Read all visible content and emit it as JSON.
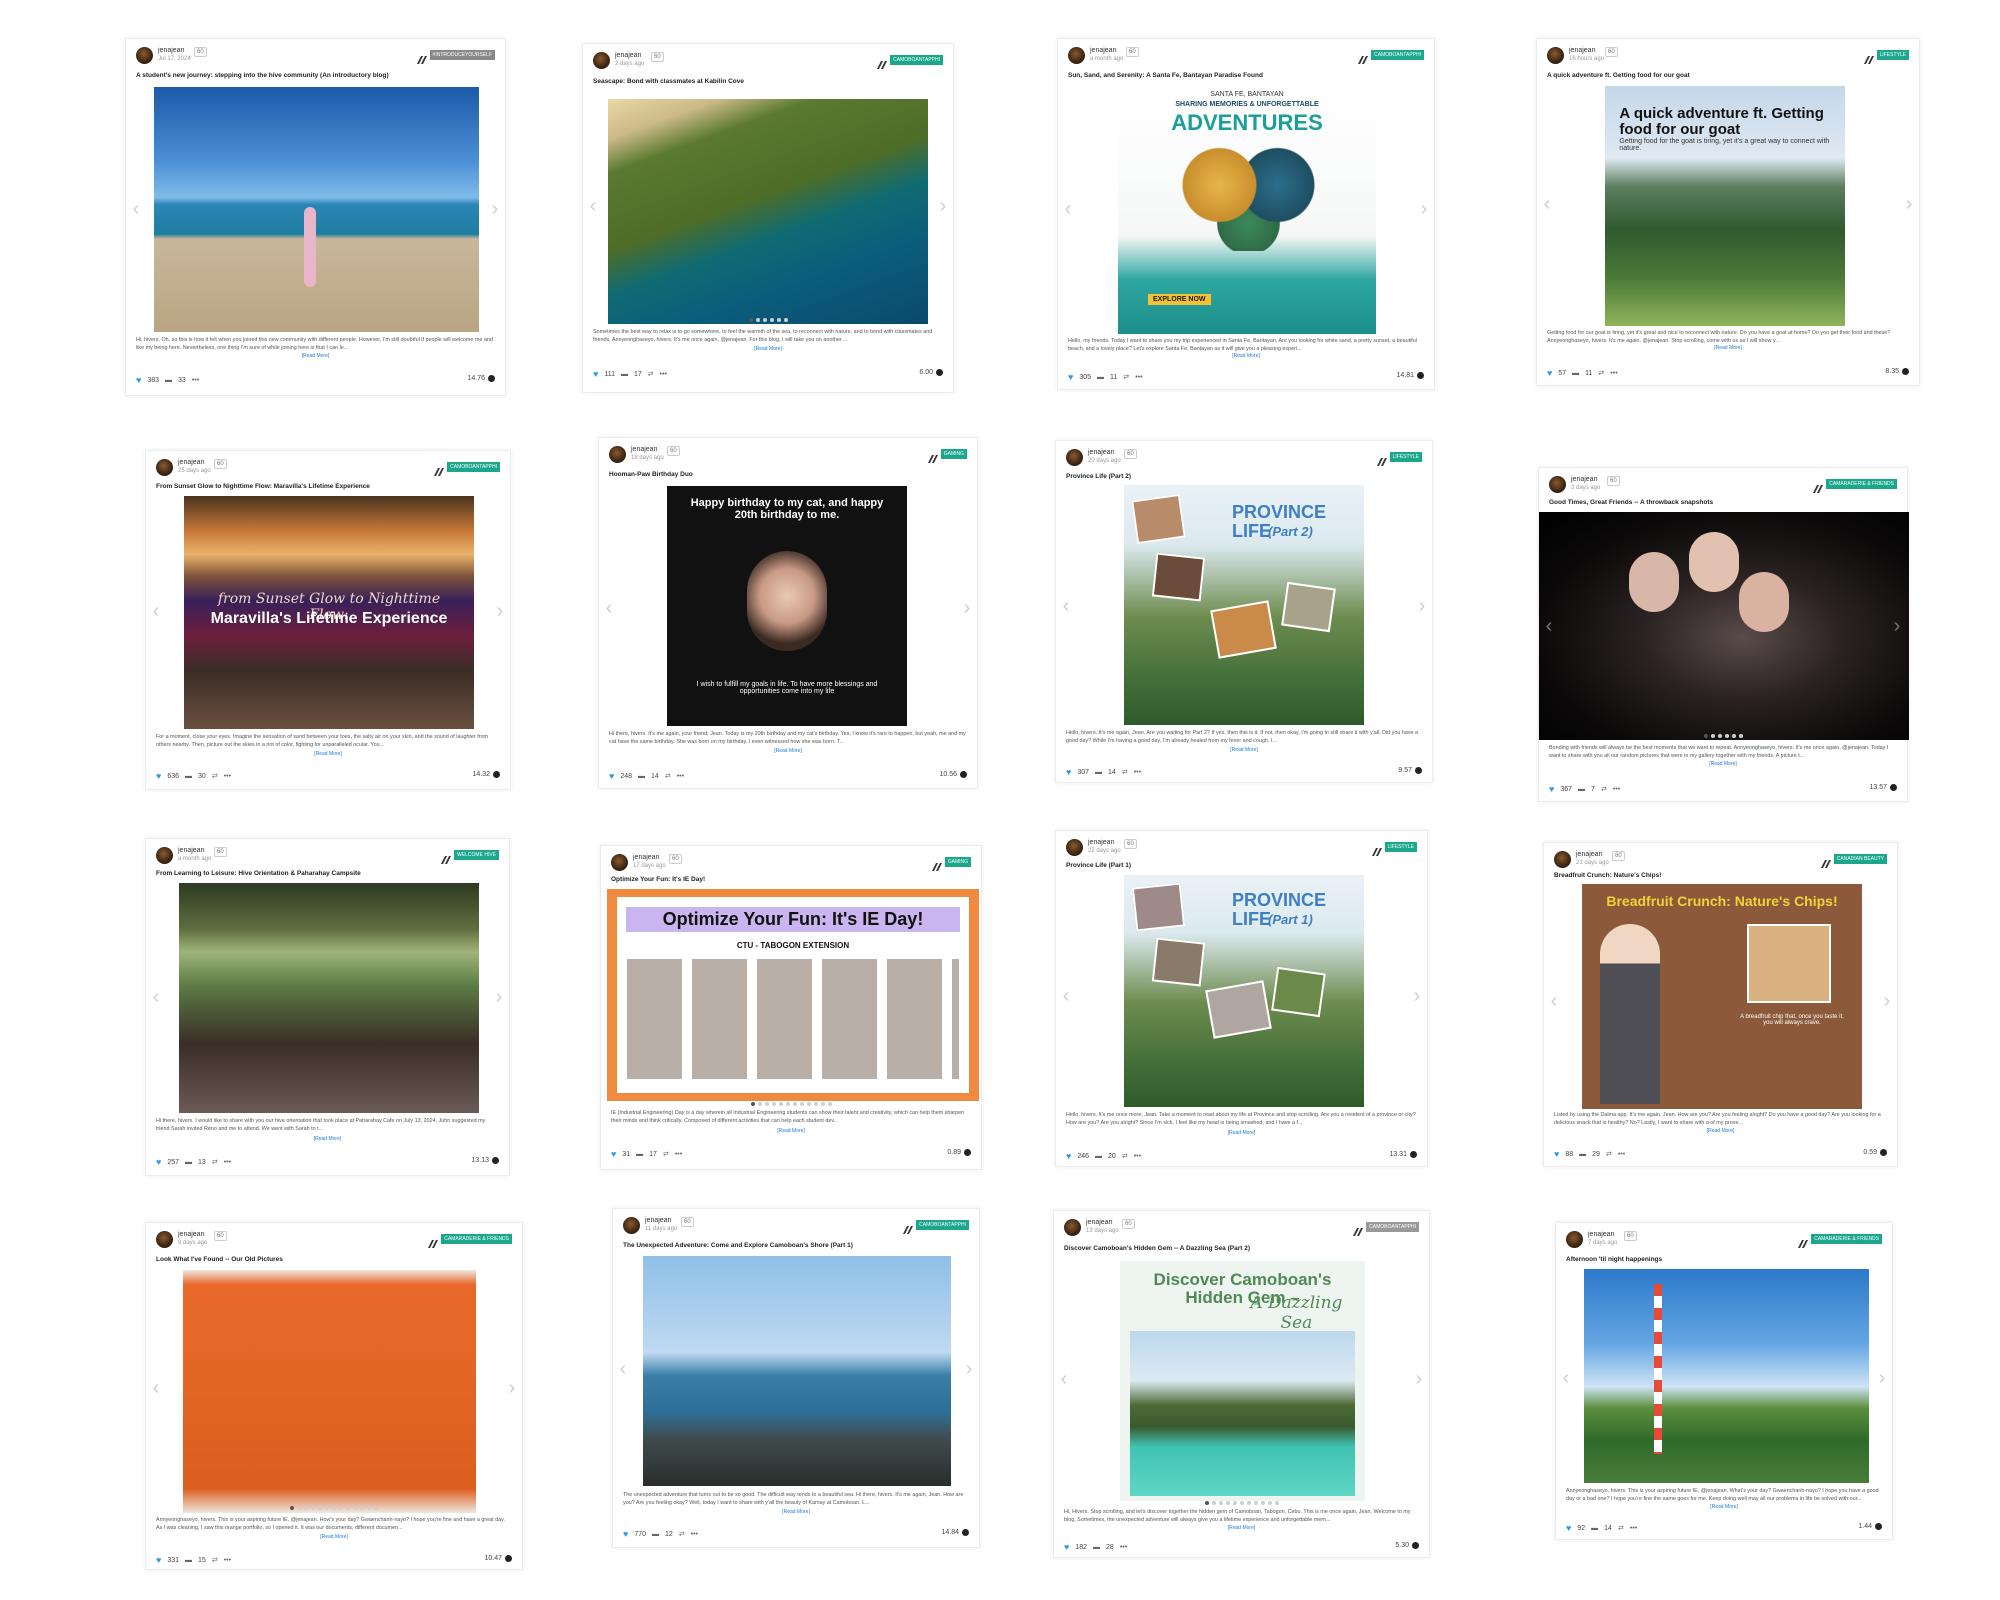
{
  "common": {
    "username": "jenajean",
    "reputation": "60",
    "read_more": "[Read More]"
  },
  "cards": [
    {
      "date": "Jul 17, 2024",
      "community": "#INTRODUCEYOURSELF",
      "title": "A student's new journey: stepping into the hive community (An introductory blog)",
      "excerpt": "Hi, hivers. Oh, so this is how it felt when you joined this new community with different people. However, I'm still doubtful if people will welcome me and like my being here. Nevertheless, one thing I'm sure of while joining here is that I can le...",
      "votes": "383",
      "comments": "33",
      "payout": "14.76"
    },
    {
      "date": "2 days ago",
      "community": "CAMOBOANTAPPHI",
      "title": "Seascape: Bond with classmates at Kabilin Cove",
      "excerpt": "Sometimes the best way to relax is to go somewhere, to feel the warmth of the sea, to reconnect with nature, and to bond with classmates and friends. Annyeonghaseyo, hivers. It's me once again, @jenajean. For this blog, I will take you on another ...",
      "votes": "111",
      "comments": "17",
      "payout": "6.00"
    },
    {
      "date": "a month ago",
      "community": "CAMOBOANTAPPHI",
      "title": "Sun, Sand, and Serenity: A Santa Fe, Bantayan Paradise Found",
      "image_sub": "SANTA FE, BANTAYAN",
      "image_title1": "SHARING MEMORIES & UNFORGETTABLE",
      "image_title2": "ADVENTURES",
      "image_button": "EXPLORE NOW",
      "excerpt": "Hello, my friends. Today I want to share you my trip experienced in Santa Fe, Bantayan. Are you looking for white sand, a pretty sunset, a beautiful beach, and a lovely place? Let's explore Santa Fe, Bantayan as it will give you a pleasing experi...",
      "votes": "305",
      "comments": "11",
      "payout": "14.81"
    },
    {
      "date": "16 hours ago",
      "community": "LIFESTYLE",
      "title": "A quick adventure ft. Getting food for our goat",
      "image_title": "A quick adventure ft. Getting food for our goat",
      "image_sub": "Getting food for the goat is tiring, yet it's a great way to connect with nature.",
      "excerpt": "Getting food for our goat is tiring, yet it's great and nice to reconnect with nature. Do you have a goat at home? Do you get their food and these? Annyeonghaseyo, hivers. It's me again, @jenajean. Stop scrolling, come with us as I will show y...",
      "votes": "57",
      "comments": "11",
      "payout": "8.35"
    },
    {
      "date": "25 days ago",
      "community": "CAMOBOANTAPPHI",
      "title": "From Sunset Glow to Nighttime Flow: Maravilla's Lifetime Experience",
      "image_script": "from Sunset Glow to Nighttime Flow:",
      "image_title": "Maravilla's Lifetime Experience",
      "excerpt": "For a moment, close your eyes. Imagine the sensation of sand between your toes, the salty air on your skin, and the sound of laughter from others nearby. Then, picture out the skies in a riot of color, fighting for unparalleled ocular. You...",
      "votes": "636",
      "comments": "30",
      "payout": "14.32"
    },
    {
      "date": "18 days ago",
      "community": "GAMING",
      "title": "Hooman-Paw Birthday Duo",
      "image_title": "Happy birthday to my cat, and happy 20th birthday to me.",
      "image_caption": "I wish to fulfill my goals in life. To have more blessings and opportunities come into my life",
      "excerpt": "Hi there, hivers. It's me again, your friend, Jean. Today is my 20th birthday and my cat's birthday. Yes, I know it's rare to happen, but yeah, me and my cat have the same birthday. She was born on my birthday. I even witnessed how she was born. T...",
      "votes": "248",
      "comments": "14",
      "payout": "10.56"
    },
    {
      "date": "20 days ago",
      "community": "LIFESTYLE",
      "title": "Province Life (Part 2)",
      "image_title": "PROVINCE LIFE",
      "image_part": "(Part 2)",
      "excerpt": "Hello, hivers. It's me again, Jean. Are you waiting for Part 2? If yes, then this is it. If not, then okay, I'm going to still share it with y'all. Did you have a good day? While I'm having a good day, I'm already healed from my fever and cough. I...",
      "votes": "307",
      "comments": "14",
      "payout": "9.57"
    },
    {
      "date": "3 days ago",
      "community": "CAMARADERIE & FRIENDS",
      "title": "Good Times, Great Friends -- A throwback snapshots",
      "excerpt": "Bonding with friends will always be the best moments that we want to repeat. Annyeonghaseyo, hivers. It's me once again, @jenajean. Today I want to share with you all our random pictures that were in my gallery together with my friends. A picture t...",
      "votes": "367",
      "comments": "7",
      "payout": "13.57"
    },
    {
      "date": "a month ago",
      "community": "WELCOME HIVE",
      "title": "From Learning to Leisure: Hive Orientation & Paharahay Campsite",
      "excerpt": "Hi there, hivers. I would like to share with you our hive orientation that took place at Paharahay Cafe on July 13, 2024. Juhn suggested my friend Sarah invited Reno and me to attend. We went with Sarah to t...",
      "votes": "257",
      "comments": "13",
      "payout": "13.13"
    },
    {
      "date": "17 days ago",
      "community": "GAMING",
      "title": "Optimize Your Fun: It's IE Day!",
      "image_title": "Optimize Your Fun: It's IE Day!",
      "image_sub": "CTU - TABOGON EXTENSION",
      "excerpt": "IE (Industrial Engineering) Day is a day wherein all Industrial Engineering students can show their talent and creativity, which can help them sharpen their minds and think critically. Composed of different activities that can help each student dev...",
      "votes": "31",
      "comments": "17",
      "payout": "0.89"
    },
    {
      "date": "22 days ago",
      "community": "LIFESTYLE",
      "title": "Province Life (Part 1)",
      "image_title": "PROVINCE LIFE",
      "image_part": "(Part 1)",
      "excerpt": "Hello, hivers. It's me once more, Jean. Take a moment to read about my life at Province and stop scrolling. Are you a resident of a province or city? How are you? Are you alright? Since I'm sick, I feel like my head is being smashed, and I have a f...",
      "votes": "246",
      "comments": "20",
      "payout": "13.31"
    },
    {
      "date": "21 days ago",
      "community": "CANADIAN BEAUTY",
      "title": "Breadfruit Crunch: Nature's Chips!",
      "image_title": "Breadfruit Crunch: Nature's Chips!",
      "image_caption": "A breadfruit chip that, once you taste it, you will always crave.",
      "excerpt": "Listed by using the Dalma app. It's me again, Jean. How are you? Are you feeling alright? Do you have a good day? Are you looking for a delicious snack that is healthy? No? Lastly, I want to share with a of my prove...",
      "votes": "88",
      "comments": "29",
      "payout": "0.59"
    },
    {
      "date": "9 days ago",
      "community": "CAMARADERIE & FRIENDS",
      "title": "Look What I've Found -- Our Old Pictures",
      "excerpt": "Annyeonghaseyo, hivers. This is your aspiring future IE, @jenajean. How's your day? Gwaenchanh-nayo? I hope you're fine and have a great day. As I was cleaning, I saw this orange portfolio, so I opened it. It was our documents, different documen...",
      "votes": "331",
      "comments": "15",
      "payout": "10.47"
    },
    {
      "date": "11 days ago",
      "community": "CAMOBOANTAPPHI",
      "title": "The Unexpected Adventure: Come and Explore Camoboan's Shore (Part 1)",
      "excerpt": "The unexpected adventure that turns out to be so good. The difficult way tends to a beautiful sea. Hi there, hivers. It's me again, Jean. How are you? Are you feeling okay? Well, today I want to share with y'all the beauty of Kamay at Camoboan. L...",
      "votes": "770",
      "comments": "12",
      "payout": "14.84"
    },
    {
      "date": "13 days ago",
      "community": "CAMOBOANTAPPHI",
      "title": "Discover Camoboan's Hidden Gem -- A Dazzling Sea (Part 2)",
      "image_title": "Discover Camoboan's Hidden Gem –",
      "image_script": "A Dazzling Sea",
      "excerpt": "Hi, Hivers. Stop scrolling, and let's discover together the hidden gem of Camoboan, Tabogon, Cebu. This is me once again, Jean. Welcome to my blog. Sometimes, the unexpected adventure will always give you a lifetime experience and unforgettable mem...",
      "votes": "182",
      "comments": "28",
      "payout": "5.30"
    },
    {
      "date": "7 days ago",
      "community": "CAMARADERIE & FRIENDS",
      "title": "Afternoon 'til night happenings",
      "excerpt": "Annyeonghaseyo, hivers. This is your aspiring future IE, @jenajean. What's your day? Gwaenchanh-nayo? I hope you have a good day or a bad one? I hope you're fine the same goes for me. Keep doing well may all our problems in life be solved with our...",
      "votes": "92",
      "comments": "14",
      "payout": "1.44"
    }
  ]
}
